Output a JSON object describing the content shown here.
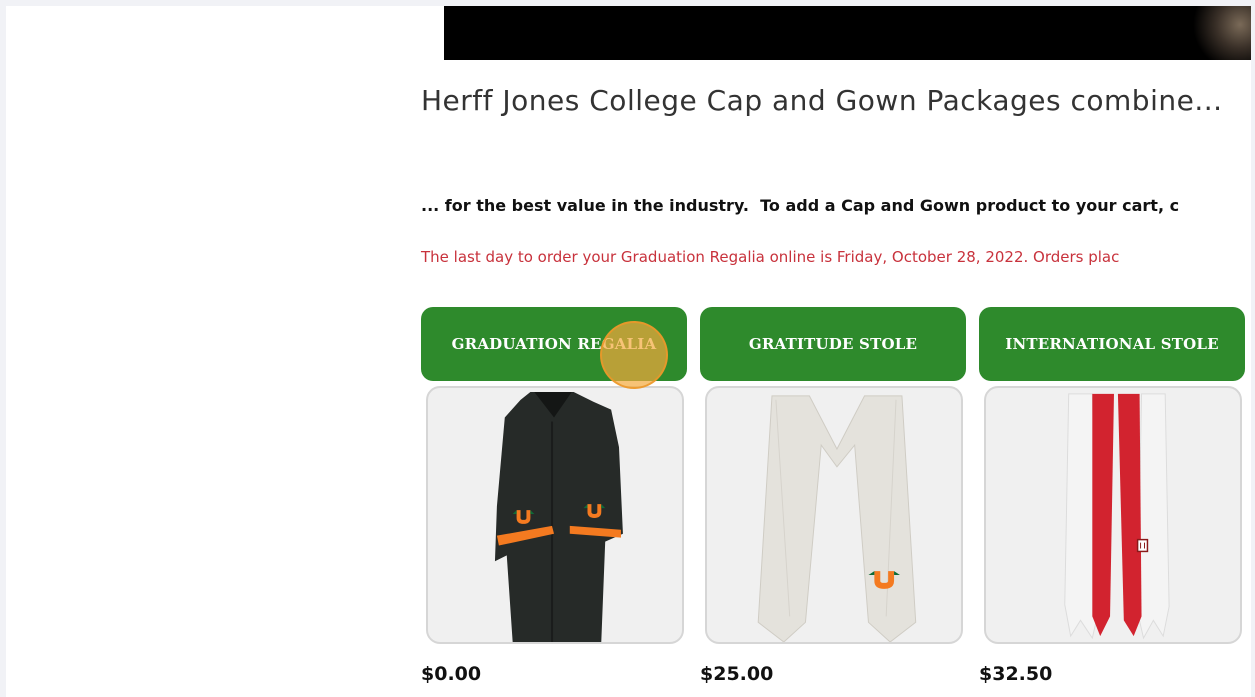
{
  "page": {
    "headline": "Herff Jones College Cap and Gown Packages combine...",
    "intro_text": "... for the best value in the industry.  To add a Cap and Gown product to your cart, c",
    "deadline_text": "The last day to order your Graduation Regalia online is Friday, October 28, 2022. Orders plac"
  },
  "products": [
    {
      "title": "GRADUATION REGALIA",
      "price": "$0.00",
      "image": "black-graduation-gown-with-orange-trim"
    },
    {
      "title": "GRATITUDE STOLE",
      "price": "$25.00",
      "image": "white-gratitude-stole"
    },
    {
      "title": "INTERNATIONAL STOLE",
      "price": "$32.50",
      "image": "red-and-white-international-stole"
    }
  ],
  "colors": {
    "product_header_bg": "#2e8a2c",
    "deadline_text": "#c8323c",
    "click_indicator": "#f4aa3c"
  }
}
